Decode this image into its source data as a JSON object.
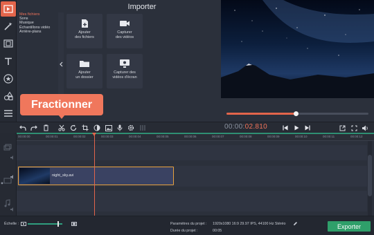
{
  "importer": {
    "title": "Importer",
    "categories": [
      "Mes fichiers",
      "Sons",
      "Musique",
      "Échantillons vidéo",
      "Arrière-plans"
    ],
    "tiles": [
      {
        "label_1": "Ajouter",
        "label_2": "des fichiers",
        "icon": "add-file-icon"
      },
      {
        "label_1": "Capturer",
        "label_2": "des vidéos",
        "icon": "camera-icon"
      },
      {
        "label_1": "Ajouter",
        "label_2": "un dossier",
        "icon": "folder-icon"
      },
      {
        "label_1": "Capturer des",
        "label_2": "vidéos d'écran",
        "icon": "screen-capture-icon"
      }
    ]
  },
  "tooltip": {
    "text": "Fractionner"
  },
  "player": {
    "time_dim": "00:00:",
    "time_hi": "02.810",
    "progress": 0.49
  },
  "ruler": {
    "ticks": [
      "00:00:00",
      "00:00:01",
      "00:00:02",
      "00:00:03",
      "00:00:04",
      "00:00:05",
      "00:00:06",
      "00:00:07",
      "00:00:08",
      "00:00:09",
      "00:00:10",
      "00:00:11",
      "00:00:12"
    ]
  },
  "timeline": {
    "clip_name": "night_sky.avi"
  },
  "bottom": {
    "scale_label": "Échelle :",
    "zoom_level": 0.88,
    "project_params_label": "Paramètres du projet :",
    "project_params_value": "1920x1080 16:9 29.97 IPS, 44100 Hz Stéréo",
    "duration_label": "Durée du projet :",
    "duration_value": "00:05",
    "export_label": "Exporter"
  },
  "colors": {
    "accent": "#e3654b",
    "export": "#2f9f6a",
    "clip_border": "#e8a23c"
  }
}
